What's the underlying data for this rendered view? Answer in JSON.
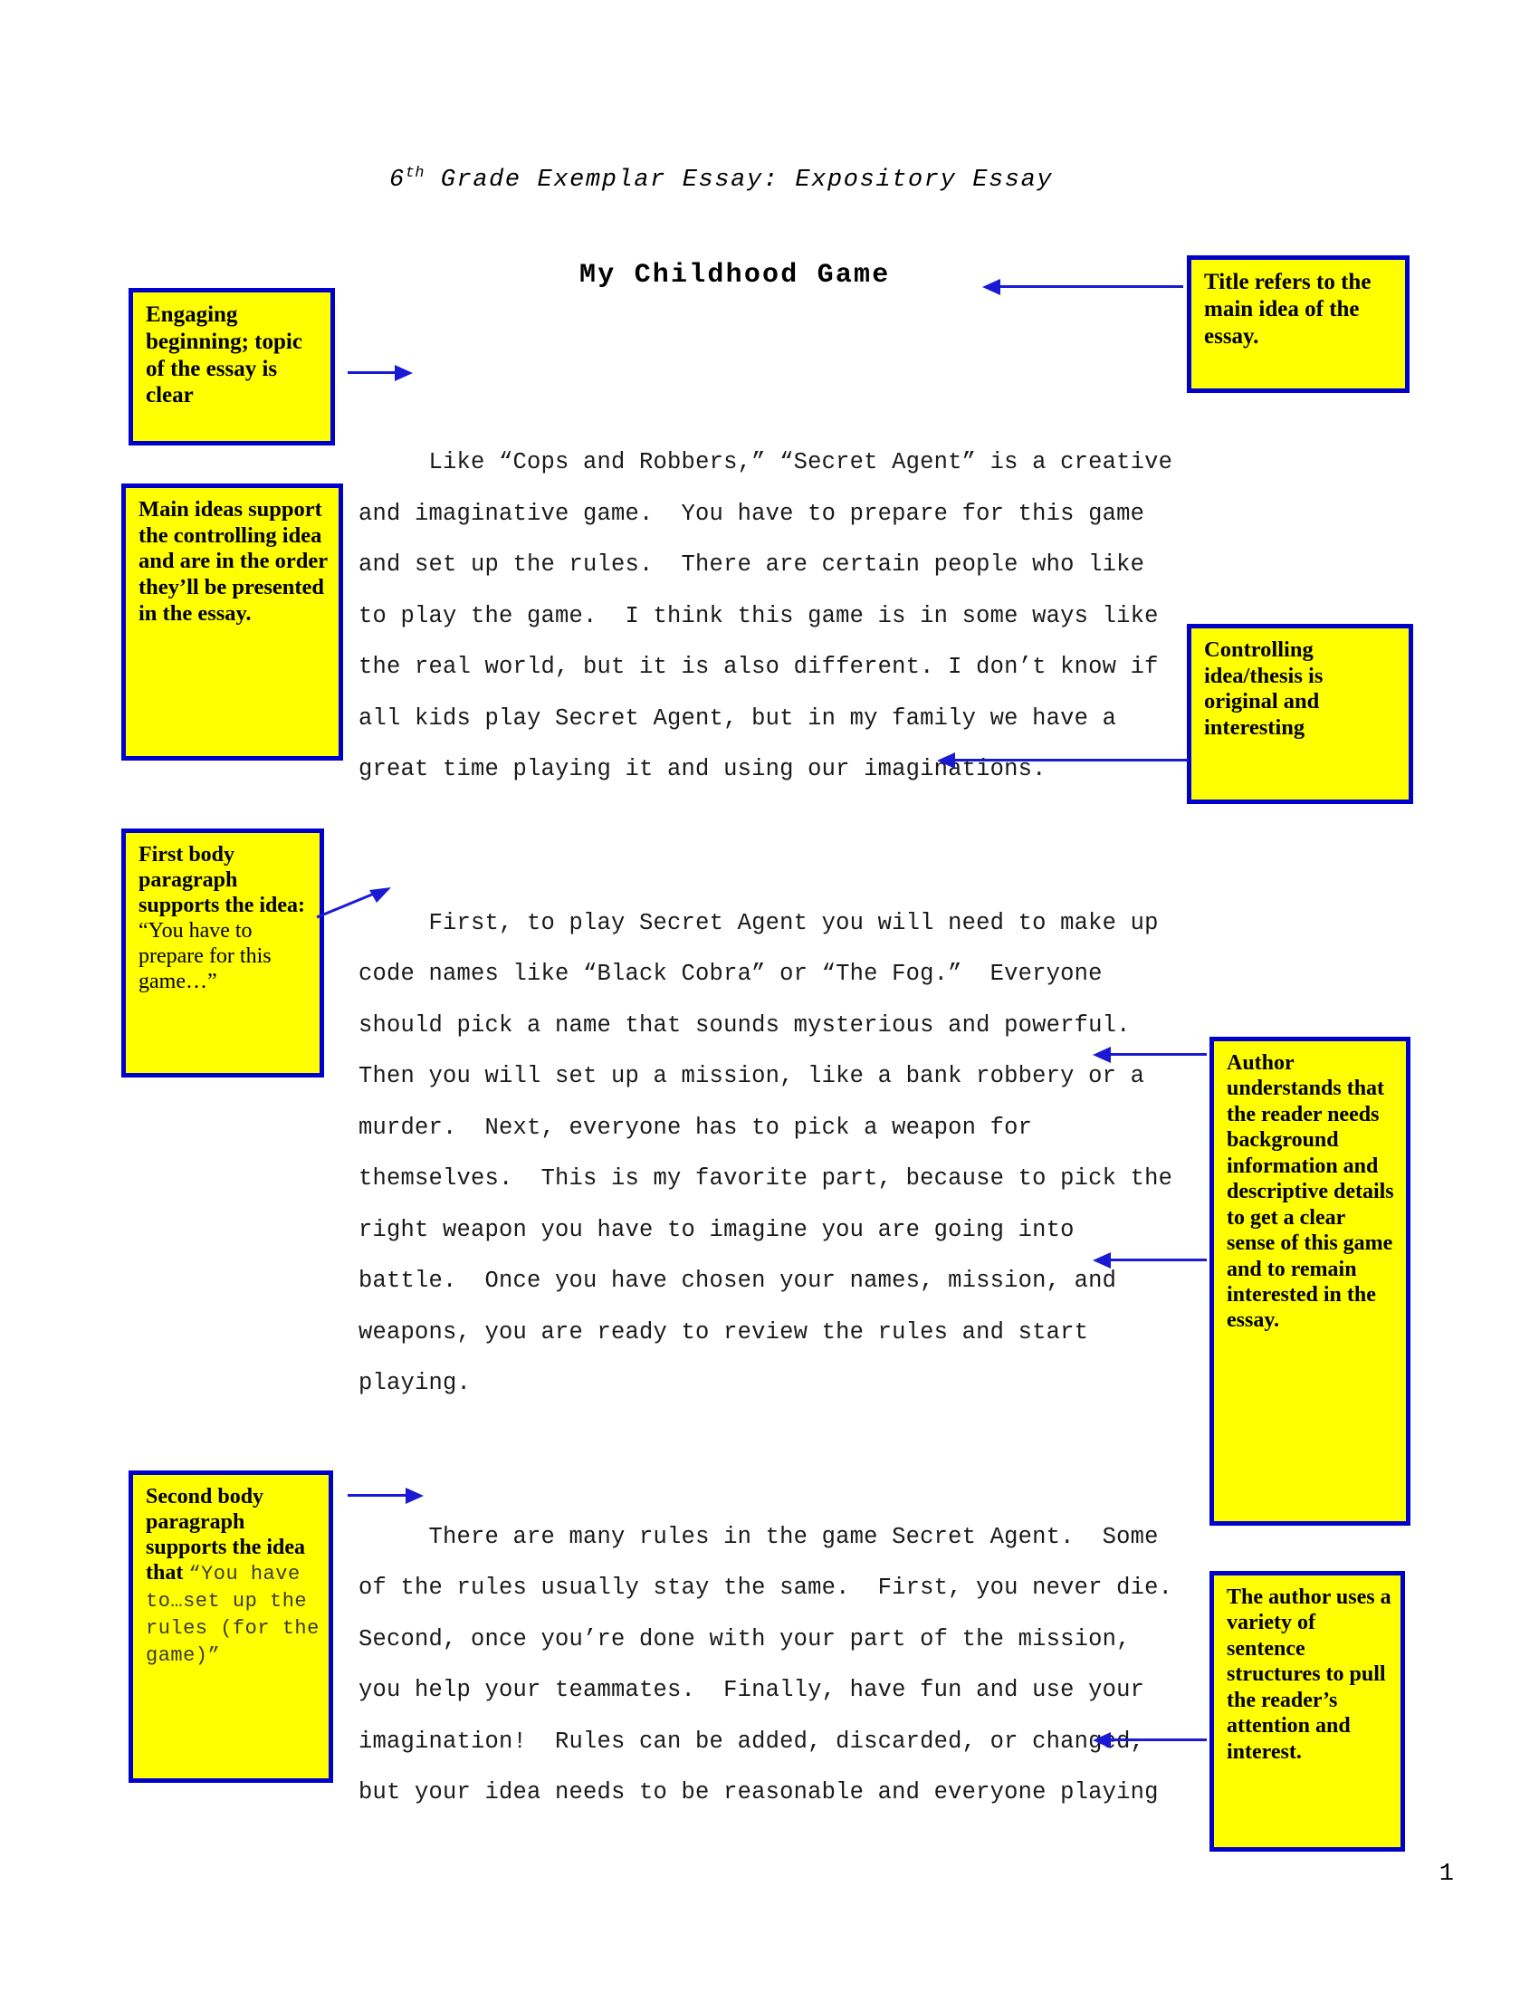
{
  "document": {
    "header_prefix": "6",
    "header_sup": "th",
    "header_rest": " Grade Exemplar Essay:  Expository Essay",
    "title": "My Childhood Game",
    "page_number": "1"
  },
  "essay": {
    "paragraph_1": "     Like “Cops and Robbers,” “Secret Agent” is a creative and imaginative game.  You have to prepare for this game and set up the rules.  There are certain people who like to play the game.  I think this game is in some ways like the real world, but it is also different. I don’t know if all kids play Secret Agent, but in my family we have a great time playing it and using our imaginations.",
    "paragraph_2": "     First, to play Secret Agent you will need to make up code names like “Black Cobra” or “The Fog.”  Everyone should pick a name that sounds mysterious and powerful.  Then you will set up a mission, like a bank robbery or a murder.  Next, everyone has to pick a weapon for themselves.  This is my favorite part, because to pick the right weapon you have to imagine you are going into battle.  Once you have chosen your names, mission, and weapons, you are ready to review the rules and start playing.",
    "paragraph_3": "     There are many rules in the game Secret Agent.  Some of the rules usually stay the same.  First, you never die.  Second, once you’re done with your part of the mission, you help your teammates.  Finally, have fun and use your imagination!  Rules can be added, discarded, or changed, but your idea needs to be reasonable and everyone playing"
  },
  "annotations": {
    "engaging_beginning": "Engaging beginning; topic of the essay is clear",
    "main_ideas": "Main ideas support the controlling idea and are in the order they’ll be presented in the essay.",
    "first_body_bold": "First body paragraph supports the idea: ",
    "first_body_quote": "“You have to prepare for this game…”",
    "second_body_bold": "Second body paragraph supports the idea that ",
    "second_body_quote": "“You have to…set up the rules (for the game)”",
    "title_refers": "Title refers to the main idea of the essay.",
    "controlling_idea": "Controlling idea/thesis is original and interesting",
    "author_understands": "Author understands that the reader needs background information and descriptive details to get a clear sense of this game and to remain interested in the essay.",
    "sentence_variety": "The author uses a variety of sentence structures to pull the reader’s attention and interest."
  },
  "colors": {
    "callout_fill": "#ffff00",
    "callout_border": "#0000cc",
    "arrow": "#1a1ad4",
    "text": "#000000"
  }
}
